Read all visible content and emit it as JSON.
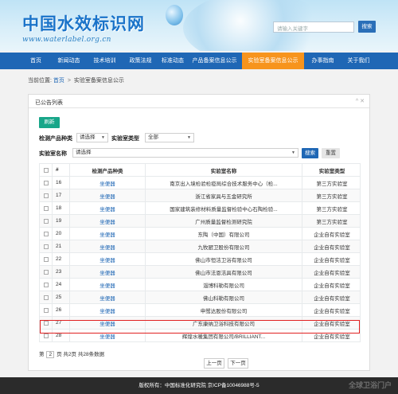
{
  "header": {
    "logo_cn": "中国水效标识网",
    "logo_url": "www.waterlabel.org.cn",
    "search_placeholder": "请输入关键字",
    "search_button": "搜索"
  },
  "nav": [
    {
      "label": "首页",
      "active": false
    },
    {
      "label": "新闻动态",
      "active": false
    },
    {
      "label": "技术培训",
      "active": false
    },
    {
      "label": "政策法规",
      "active": false
    },
    {
      "label": "标准动态",
      "active": false
    },
    {
      "label": "产品备案信息公示",
      "active": false
    },
    {
      "label": "实验室备案信息公示",
      "active": true
    },
    {
      "label": "办事指南",
      "active": false
    },
    {
      "label": "关于我们",
      "active": false
    }
  ],
  "breadcrumb": {
    "prefix": "当前位置:",
    "home": "首页",
    "sep": ">",
    "current": "实验室备案信息公示"
  },
  "panel": {
    "title": "已公告列表",
    "controls": "^ ✕",
    "refresh": "刷新",
    "filters": {
      "product_label": "检测产品种类",
      "product_value": "请选择",
      "lab_type_label": "实验室类型",
      "lab_type_value": "全部",
      "lab_name_label": "实验室名称",
      "lab_name_value": "请选择",
      "search": "搜索",
      "reset": "重置"
    }
  },
  "table": {
    "headers": {
      "num": "#",
      "product": "检测产品种类",
      "name": "实验室名称",
      "type": "实验室类型"
    },
    "rows": [
      {
        "num": "16",
        "product": "坐便器",
        "name": "南京出入境检验检疫局综合技术服务中心（检...",
        "type": "第三方实验室"
      },
      {
        "num": "17",
        "product": "坐便器",
        "name": "浙江省家具与五金研究所",
        "type": "第三方实验室"
      },
      {
        "num": "18",
        "product": "坐便器",
        "name": "国家建筑装修材料质量监督检验中心石陶检验...",
        "type": "第三方实验室"
      },
      {
        "num": "19",
        "product": "坐便器",
        "name": "广州质量监督检测研究院",
        "type": "第三方实验室"
      },
      {
        "num": "20",
        "product": "坐便器",
        "name": "东陶（中国）有限公司",
        "type": "企业自有实验室"
      },
      {
        "num": "21",
        "product": "坐便器",
        "name": "九牧厨卫股份有限公司",
        "type": "企业自有实验室"
      },
      {
        "num": "22",
        "product": "坐便器",
        "name": "佛山市恒洁卫浴有限公司",
        "type": "企业自有实验室"
      },
      {
        "num": "23",
        "product": "坐便器",
        "name": "佛山市法恩洁具有限公司",
        "type": "企业自有实验室"
      },
      {
        "num": "24",
        "product": "坐便器",
        "name": "淄博科勒有限公司",
        "type": "企业自有实验室"
      },
      {
        "num": "25",
        "product": "坐便器",
        "name": "佛山科勒有限公司",
        "type": "企业自有实验室"
      },
      {
        "num": "26",
        "product": "坐便器",
        "name": "申鹭达股份有限公司",
        "type": "企业自有实验室"
      },
      {
        "num": "27",
        "product": "坐便器",
        "name": "广东康纳卫浴科技有限公司",
        "type": "企业自有实验室"
      },
      {
        "num": "28",
        "product": "坐便器",
        "name": "辉煌水暖集团有限公司/BRILLIANT...",
        "type": "企业自有实验室"
      }
    ]
  },
  "pager": {
    "pre": "第",
    "page": "2",
    "post": "页 共2页 共28条数据",
    "prev": "上一页",
    "next": "下一页"
  },
  "footer": {
    "text": "版权所有：中国标准化研究院 京ICP备10046988号-5",
    "watermark": "全球卫浴门户"
  },
  "colors": {
    "nav_bg": "#1f67b5",
    "nav_active": "#f7941d",
    "refresh": "#18a689",
    "highlight": "#e02020"
  }
}
